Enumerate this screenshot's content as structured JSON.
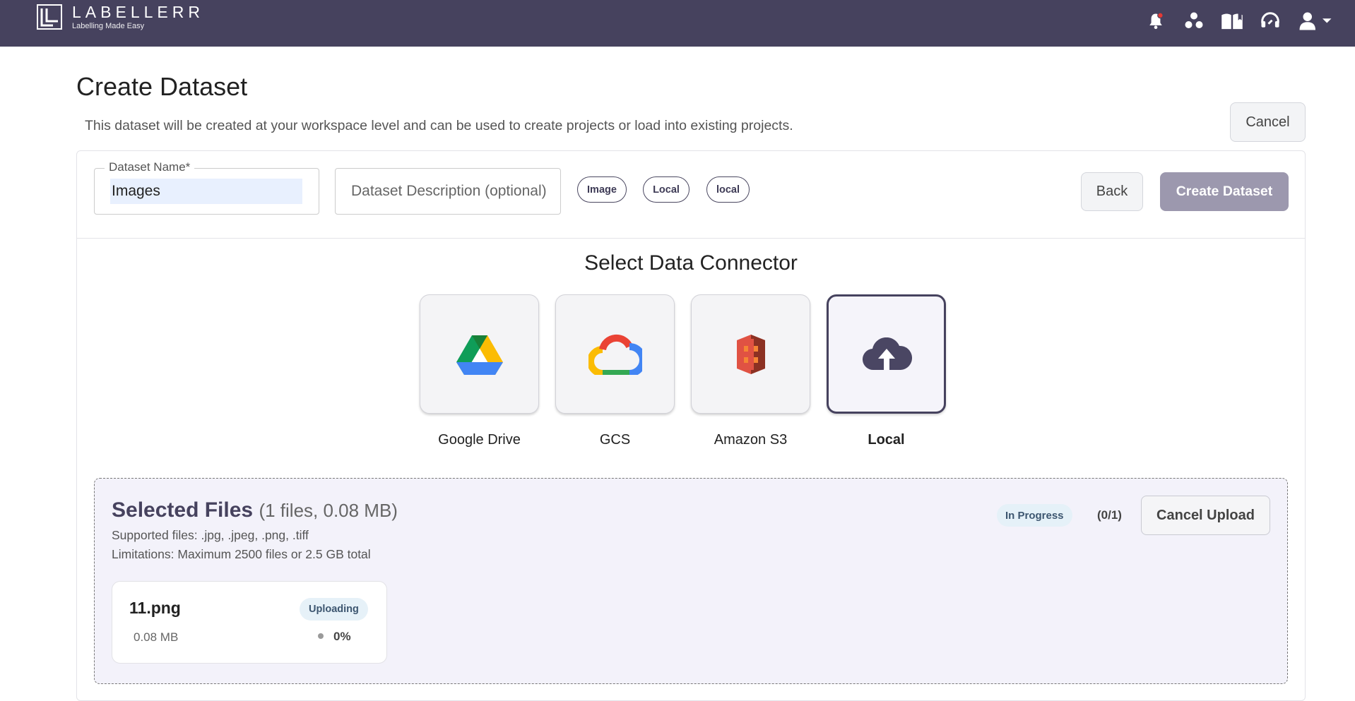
{
  "brand": {
    "name": "LABELLERR",
    "tagline": "Labelling Made Easy"
  },
  "header_icons": [
    "bell-notification-icon",
    "workspace-dots-icon",
    "docs-book-icon",
    "support-headset-icon",
    "user-account-icon"
  ],
  "page": {
    "title": "Create Dataset",
    "description": "This dataset will be created at your workspace level and can be used to create projects or load into existing projects.",
    "cancel_label": "Cancel"
  },
  "form": {
    "name_label": "Dataset Name*",
    "name_value": "Images",
    "description_placeholder": "Dataset Description (optional)",
    "chips": [
      "Image",
      "Local",
      "local"
    ],
    "back_label": "Back",
    "create_label": "Create Dataset"
  },
  "connectors": {
    "title": "Select Data Connector",
    "items": [
      {
        "label": "Google Drive",
        "icon": "google-drive-icon"
      },
      {
        "label": "GCS",
        "icon": "gcs-cloud-icon"
      },
      {
        "label": "Amazon S3",
        "icon": "amazon-s3-icon"
      },
      {
        "label": "Local",
        "icon": "cloud-upload-icon",
        "selected": true
      }
    ]
  },
  "upload": {
    "title": "Selected Files",
    "summary": "(1 files, 0.08 MB)",
    "supported": "Supported files: .jpg, .jpeg, .png, .tiff",
    "limitations": "Limitations: Maximum 2500 files or 2.5 GB total",
    "status": "In Progress",
    "count": "(0/1)",
    "cancel_label": "Cancel Upload",
    "files": [
      {
        "name": "11.png",
        "size": "0.08 MB",
        "status": "Uploading",
        "progress": "0%"
      }
    ]
  },
  "colors": {
    "nav_bg": "#46425e",
    "accent": "#46425e",
    "notification_dot": "#e53935",
    "create_disabled": "#9c98ae"
  }
}
